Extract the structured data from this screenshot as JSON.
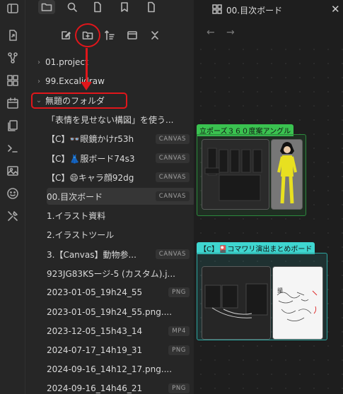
{
  "ribbon": {
    "icons": [
      "sidebar-toggle-icon",
      "open-quick-switcher-icon",
      "graph-view-icon",
      "canvas-icon",
      "calendar-icon",
      "templates-icon",
      "terminal-icon",
      "image-icon",
      "emoji-icon",
      "tools-icon"
    ]
  },
  "sidebar": {
    "tabs": [
      "files-icon",
      "search-icon",
      "file-icon",
      "bookmark-icon",
      "file-icon"
    ],
    "actions": [
      "new-note-icon",
      "new-folder-icon",
      "sort-icon",
      "collapse-icon",
      "collapse-all-icon"
    ],
    "tree": [
      {
        "label": "01.project",
        "type": "folder",
        "expanded": false
      },
      {
        "label": "99.Excalidraw",
        "type": "folder",
        "expanded": false
      },
      {
        "label": "無題のフォルダ",
        "type": "folder",
        "expanded": true
      },
      {
        "label": "「表情を見せない構図」を使う...",
        "type": "file",
        "badge": ""
      },
      {
        "label": "【C】👓眼鏡かけr53h",
        "type": "file",
        "badge": "CANVAS"
      },
      {
        "label": "【C】👗服ボード74s3",
        "type": "file",
        "badge": "CANVAS"
      },
      {
        "label": "【C】😄キャラ顔92dg",
        "type": "file",
        "badge": "CANVAS"
      },
      {
        "label": "00.目次ボード",
        "type": "file",
        "badge": "CANVAS",
        "active": true
      },
      {
        "label": "1.イラスト資料",
        "type": "file",
        "badge": ""
      },
      {
        "label": "2.イラストツール",
        "type": "file",
        "badge": ""
      },
      {
        "label": "3.【Canvas】動物参...",
        "type": "file",
        "badge": "CANVAS"
      },
      {
        "label": "923JG83KSージ-5 (カスタム).j...",
        "type": "file",
        "badge": ""
      },
      {
        "label": "2023-01-05_19h24_55",
        "type": "file",
        "badge": "PNG"
      },
      {
        "label": "2023-01-05_19h24_55.png....",
        "type": "file",
        "badge": ""
      },
      {
        "label": "2023-12-05_15h43_14",
        "type": "file",
        "badge": "MP4"
      },
      {
        "label": "2024-07-17_14h19_31",
        "type": "file",
        "badge": "PNG"
      },
      {
        "label": "2024-09-16_14h12_17.png....",
        "type": "file",
        "badge": ""
      },
      {
        "label": "2024-09-16_14h46_21",
        "type": "file",
        "badge": "PNG"
      }
    ]
  },
  "main": {
    "tab_title": "00.目次ボード",
    "back": "←",
    "forward": "→",
    "close": "✕",
    "groups": [
      {
        "label": "立ポーズ３６０度案アングル"
      },
      {
        "label": "【C】🎴コマワリ演出まとめボード"
      }
    ]
  },
  "colors": {
    "accent_red": "#e0161b",
    "group1": "#3ac250",
    "group2": "#3fd6d0"
  }
}
